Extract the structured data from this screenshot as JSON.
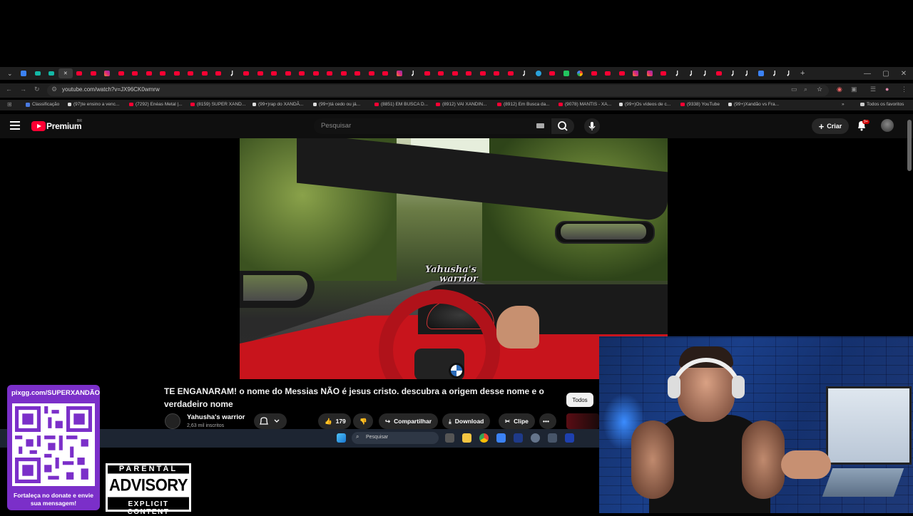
{
  "browser": {
    "url": "youtube.com/watch?v=JX96CK0wmrw",
    "tabs_favicons": [
      "down",
      "blue",
      "teal",
      "teal",
      "close",
      "yt",
      "yt",
      "ig",
      "yt",
      "yt",
      "yt",
      "yt",
      "yt",
      "yt",
      "yt",
      "yt",
      "tt",
      "yt",
      "yt",
      "yt",
      "yt",
      "yt",
      "yt",
      "yt",
      "yt",
      "yt",
      "yt",
      "yt",
      "ig",
      "tt",
      "yt",
      "yt",
      "yt",
      "yt",
      "yt",
      "yt",
      "yt",
      "tt",
      "tg",
      "yt",
      "green",
      "goog",
      "yt",
      "yt",
      "yt",
      "ig",
      "ig",
      "yt",
      "tt",
      "tt",
      "tt",
      "yt",
      "tt",
      "tt",
      "blue",
      "tt",
      "tt"
    ],
    "bookmarks": [
      {
        "label": "Classificação",
        "icon": "ic"
      },
      {
        "label": "(97)te ensino a venc...",
        "icon": "tt"
      },
      {
        "label": "(7292) Enéas Metal |...",
        "icon": "yt"
      },
      {
        "label": "(8159) SUPER XAND...",
        "icon": "yt"
      },
      {
        "label": "(99+)rap do XANDÃ...",
        "icon": "tt"
      },
      {
        "label": "(99+)tá cedo ou já...",
        "icon": "tt"
      },
      {
        "label": "(8851) EM BUSCA D...",
        "icon": "yt"
      },
      {
        "label": "(8912) VAI XANDIN...",
        "icon": "yt"
      },
      {
        "label": "(8912) Em Busca da...",
        "icon": "yt"
      },
      {
        "label": "(9078) MANTIS - XA...",
        "icon": "yt"
      },
      {
        "label": "(99+)Os vídeos de c...",
        "icon": "tt"
      },
      {
        "label": "(9338) YouTube",
        "icon": "yt"
      },
      {
        "label": "(99+)Xandão vs Fra...",
        "icon": "tt"
      }
    ],
    "all_bookmarks": "Todos os favoritos"
  },
  "youtube": {
    "brand": "Premium",
    "region": "BR",
    "search_placeholder": "Pesquisar",
    "create_label": "Criar",
    "notif_badge": "9+",
    "video": {
      "watermark_line1": "Yahusha's",
      "watermark_line2": "warrior",
      "title": "TE ENGANARAM! o nome do Messias NÃO é jesus cristo. descubra a origem desse nome e o verdadeiro nome",
      "channel": "Yahusha's warrior",
      "subscribers": "2,63 mil inscritos",
      "likes": "179",
      "share": "Compartilhar",
      "download": "Download",
      "clip": "Clipe",
      "more": "•••",
      "filter_chip": "Todos"
    }
  },
  "taskbar": {
    "search_label": "Pesquisar"
  },
  "overlay": {
    "donate_url": "pixgg.com/SUPERXANDÃO",
    "donate_msg": "Fortaleça no donate e envie sua mensagem!",
    "advisory_top": "PARENTAL",
    "advisory_mid": "ADVISORY",
    "advisory_bottom": "EXPLICIT CONTENT"
  }
}
